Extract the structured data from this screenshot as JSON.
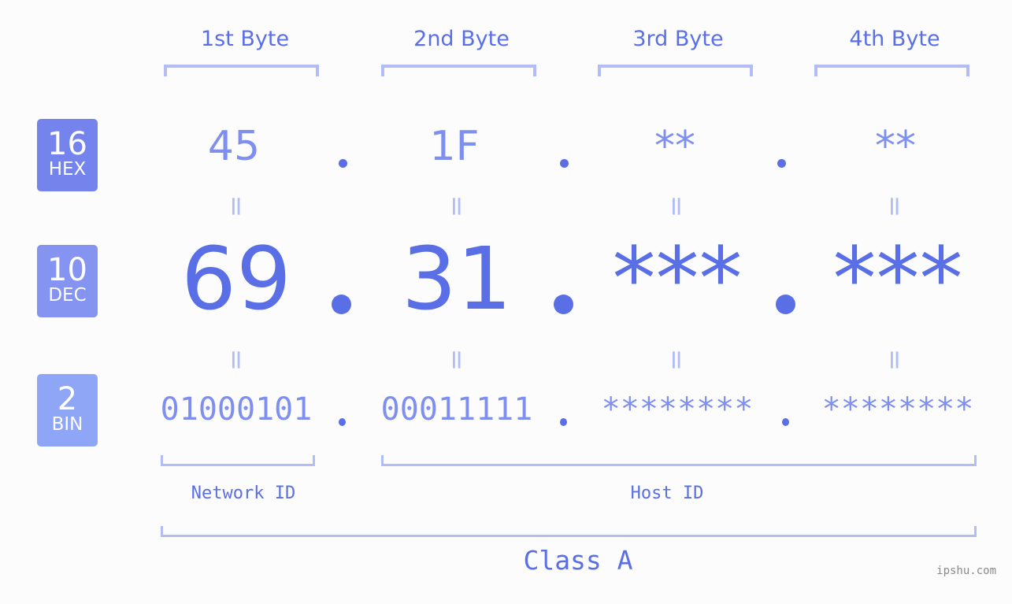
{
  "header": {
    "bytes": [
      "1st Byte",
      "2nd Byte",
      "3rd Byte",
      "4th Byte"
    ]
  },
  "badges": [
    {
      "number": "16",
      "label": "HEX",
      "color": "#7583ec"
    },
    {
      "number": "10",
      "label": "DEC",
      "color": "#8494f0"
    },
    {
      "number": "2",
      "label": "BIN",
      "color": "#8fa6f6"
    }
  ],
  "rows": {
    "hex": [
      "45",
      "1F",
      "**",
      "**"
    ],
    "dec": [
      "69",
      "31",
      "***",
      "***"
    ],
    "bin": [
      "01000101",
      "00011111",
      "********",
      "********"
    ]
  },
  "separator": "=",
  "labels": {
    "network_id": "Network ID",
    "host_id": "Host ID",
    "class": "Class A"
  },
  "watermark": "ipshu.com",
  "colors": {
    "accent": "#5a6fe6",
    "light": "#7e8ff0",
    "bracket": "#b3bdf5"
  }
}
